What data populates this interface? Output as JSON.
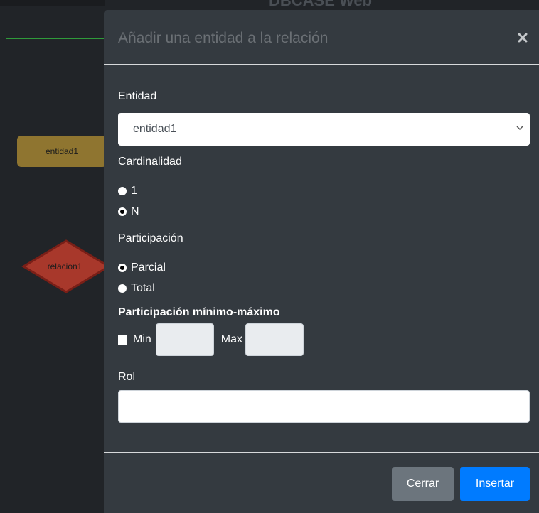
{
  "background": {
    "app_title": "DBCASE Web",
    "entity_node": {
      "label": "entidad1",
      "color": "#8f7530"
    },
    "relation_node": {
      "label": "relacion1",
      "color": "#a8382b"
    },
    "accent_line_color": "#2f9a3a"
  },
  "modal": {
    "title": "Añadir una entidad a la relación",
    "close_icon": "times-icon",
    "entity": {
      "label": "Entidad",
      "selected": "entidad1"
    },
    "cardinality": {
      "label": "Cardinalidad",
      "options": [
        {
          "label": "1",
          "checked": false
        },
        {
          "label": "N",
          "checked": true
        }
      ]
    },
    "participation": {
      "label": "Participación",
      "options": [
        {
          "label": "Parcial",
          "checked": true
        },
        {
          "label": "Total",
          "checked": false
        }
      ]
    },
    "minmax": {
      "label": "Participación mínimo-máximo",
      "checkbox_checked": false,
      "min_label": "Min",
      "max_label": "Max",
      "min_value": "",
      "max_value": ""
    },
    "role": {
      "label": "Rol",
      "value": ""
    },
    "buttons": {
      "close_label": "Cerrar",
      "insert_label": "Insertar",
      "primary_color": "#007bff",
      "secondary_color": "#6c757d"
    }
  }
}
